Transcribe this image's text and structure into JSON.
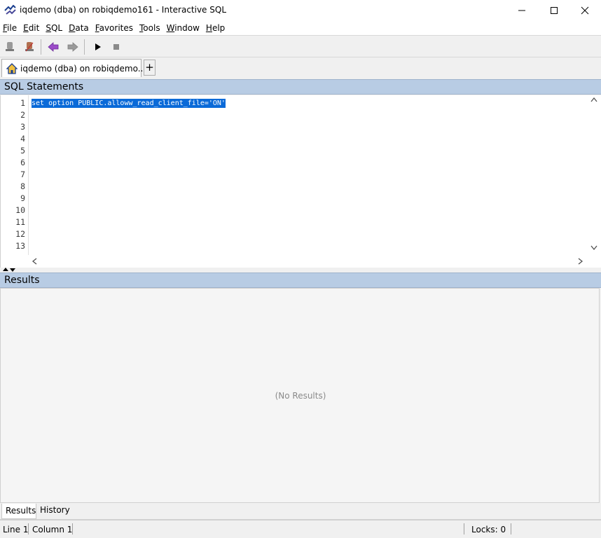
{
  "window": {
    "title": "iqdemo (dba) on robiqdemo161 - Interactive SQL"
  },
  "menu": [
    "File",
    "Edit",
    "SQL",
    "Data",
    "Favorites",
    "Tools",
    "Window",
    "Help"
  ],
  "toolbar": {
    "icons": [
      "connect-icon",
      "disconnect-icon",
      "back-arrow-icon",
      "forward-arrow-icon",
      "execute-icon",
      "stop-icon"
    ]
  },
  "tabs": {
    "active_label": "iqdemo (dba) on robiqdemo...",
    "add_label": "+"
  },
  "sql_panel": {
    "header": "SQL Statements",
    "lines": [
      "1",
      "2",
      "3",
      "4",
      "5",
      "6",
      "7",
      "8",
      "9",
      "10",
      "11",
      "12",
      "13"
    ],
    "code": "set option PUBLIC.alloww_read_client_file='ON'"
  },
  "results_panel": {
    "header": "Results",
    "empty_text": "(No Results)"
  },
  "bottom_tabs": [
    "Results",
    "History"
  ],
  "status": {
    "line": "Line 1",
    "column": "Column 1",
    "locks": "Locks: 0"
  },
  "colors": {
    "panel_header": "#b8cce4",
    "selection": "#0a6ad8"
  }
}
